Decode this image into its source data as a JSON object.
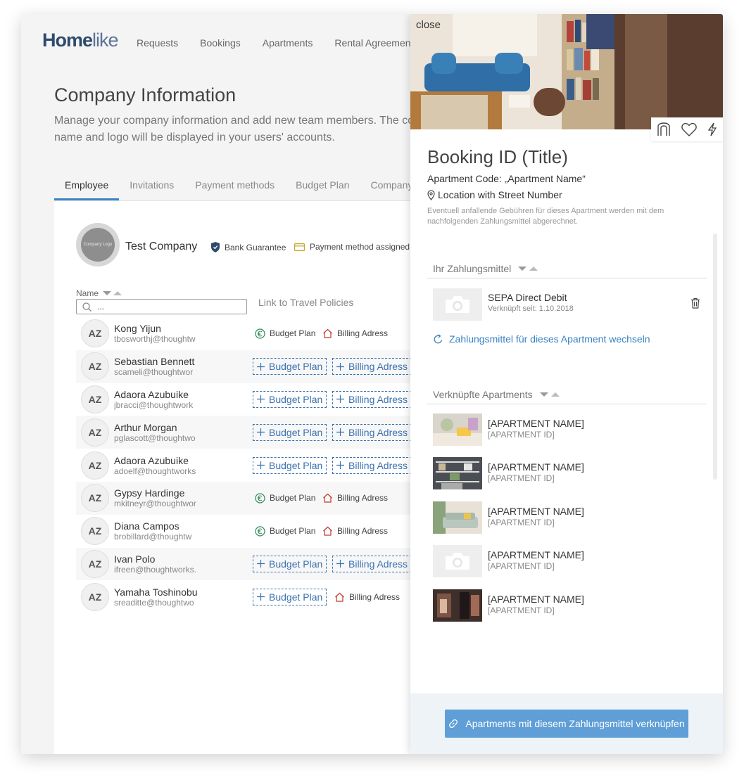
{
  "app": {
    "logo_main": "Home",
    "logo_lite": "like",
    "nav": [
      "Requests",
      "Bookings",
      "Apartments",
      "Rental Agreements"
    ]
  },
  "page": {
    "title": "Company Information",
    "subtitle": "Manage your company information and add new team members. The company name and logo will be displayed in your users' accounts.",
    "tabs": [
      "Employee",
      "Invitations",
      "Payment methods",
      "Budget Plan",
      "Company"
    ],
    "active_tab": "Employee"
  },
  "company": {
    "logo_text": "Company Logo",
    "name": "Test Company",
    "badge_guarantee": "Bank Guarantee",
    "badge_payment": "Payment method assigned"
  },
  "table": {
    "name_header": "Name",
    "search_placeholder": "...",
    "link_header": "Link to Travel Policies",
    "budget_label": "Budget Plan",
    "billing_label": "Billing Adress",
    "rows": [
      {
        "initials": "AZ",
        "name": "Kong Yijun",
        "email": "tbosworthj@thoughtw",
        "assigned": true
      },
      {
        "initials": "AZ",
        "name": "Sebastian Bennett",
        "email": "scameli@thoughtwor",
        "assigned": false
      },
      {
        "initials": "AZ",
        "name": "Adaora Azubuike",
        "email": "jbracci@thoughtwork",
        "assigned": false
      },
      {
        "initials": "AZ",
        "name": "Arthur Morgan",
        "email": "pglascott@thoughtwo",
        "assigned": false
      },
      {
        "initials": "AZ",
        "name": "Adaora Azubuike",
        "email": "adoelf@thoughtworks",
        "assigned": false
      },
      {
        "initials": "AZ",
        "name": "Gypsy Hardinge",
        "email": "mkitneyr@thoughtwor",
        "assigned": true
      },
      {
        "initials": "AZ",
        "name": "Diana Campos",
        "email": "brobillard@thoughtw",
        "assigned": true
      },
      {
        "initials": "AZ",
        "name": "Ivan Polo",
        "email": "ifreen@thoughtworks.",
        "assigned": false
      },
      {
        "initials": "AZ",
        "name": "Yamaha Toshinobu",
        "email": "sreaditte@thoughtwo",
        "assigned": "billing-only"
      }
    ]
  },
  "panel": {
    "close": "close",
    "booking_title": "Booking ID (Title)",
    "apartment_code": "Apartment Code: „Apartment Name“",
    "location": "Location with Street Number",
    "note": "Eventuell anfallende Gebühren für dieses Apartment werden mit dem nachfolgenden Zahlungsmittel abgerechnet.",
    "payment_section": "Ihr Zahlungsmittel",
    "payment_name": "SEPA Direct Debit",
    "payment_since": "Verknüpft seit: 1.10.2018",
    "switch_link": "Zahlungsmittel für dieses Apartment wechseln",
    "apartments_section": "Verknüpfte Apartments",
    "apartments": [
      {
        "name": "[APARTMENT NAME]",
        "id": "[APARTMENT ID]",
        "thumb": "table"
      },
      {
        "name": "[APARTMENT NAME]",
        "id": "[APARTMENT ID]",
        "thumb": "shelf"
      },
      {
        "name": "[APARTMENT NAME]",
        "id": "[APARTMENT ID]",
        "thumb": "sofa"
      },
      {
        "name": "[APARTMENT NAME]",
        "id": "[APARTMENT ID]",
        "thumb": "placeholder"
      },
      {
        "name": "[APARTMENT NAME]",
        "id": "[APARTMENT ID]",
        "thumb": "room"
      }
    ],
    "link_button": "Apartments mit diesem Zahlungsmittel verknüpfen"
  },
  "colors": {
    "accent": "#3a82c4",
    "button": "#5f9ed6",
    "footer_bg": "#eef3f8",
    "budget_icon": "#2e8b57",
    "billing_icon": "#c0392b"
  }
}
